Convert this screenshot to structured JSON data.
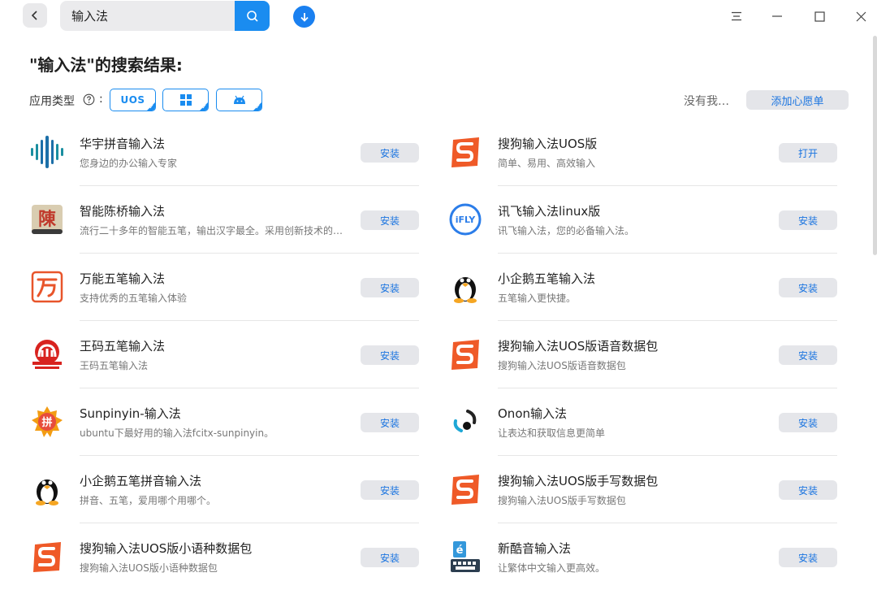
{
  "search": {
    "value": "输入法"
  },
  "results_title": "\"输入法\"的搜索结果:",
  "filter": {
    "label": "应用类型",
    "colon": ":",
    "uos_chip": "UOS",
    "no_find": "没有我…",
    "wish_button": "添加心愿单"
  },
  "colors": {
    "accent": "#1a8cf0",
    "button_bg": "#e5e6ea",
    "button_text": "#1a74e0"
  },
  "apps": [
    {
      "name": "华宇拼音输入法",
      "desc": "您身边的办公输入专家",
      "button": "安装",
      "icon": "huayu-pinyin-icon"
    },
    {
      "name": "搜狗输入法UOS版",
      "desc": "简单、易用、高效输入",
      "button": "打开",
      "icon": "sogou-icon"
    },
    {
      "name": "智能陈桥输入法",
      "desc": "流行二十多年的智能五笔，输出汉字最全。采用创新技术的…",
      "button": "安装",
      "icon": "chenqiao-icon"
    },
    {
      "name": "讯飞输入法linux版",
      "desc": "讯飞输入法，您的必备输入法。",
      "button": "安装",
      "icon": "ifly-icon"
    },
    {
      "name": "万能五笔输入法",
      "desc": "支持优秀的五笔输入体验",
      "button": "安装",
      "icon": "wanneng-wubi-icon"
    },
    {
      "name": "小企鹅五笔输入法",
      "desc": "五笔输入更快捷。",
      "button": "安装",
      "icon": "penguin-icon"
    },
    {
      "name": "王码五笔输入法",
      "desc": "王码五笔输入法",
      "button": "安装",
      "icon": "wangma-icon"
    },
    {
      "name": "搜狗输入法UOS版语音数据包",
      "desc": "搜狗输入法UOS版语音数据包",
      "button": "安装",
      "icon": "sogou-icon"
    },
    {
      "name": "Sunpinyin-输入法",
      "desc": "ubuntu下最好用的输入法fcitx-sunpinyin。",
      "button": "安装",
      "icon": "sunpinyin-icon"
    },
    {
      "name": "Onon输入法",
      "desc": "让表达和获取信息更简单",
      "button": "安装",
      "icon": "onon-icon"
    },
    {
      "name": "小企鹅五笔拼音输入法",
      "desc": "拼音、五笔，爱用哪个用哪个。",
      "button": "安装",
      "icon": "penguin-icon"
    },
    {
      "name": "搜狗输入法UOS版手写数据包",
      "desc": "搜狗输入法UOS版手写数据包",
      "button": "安装",
      "icon": "sogou-icon"
    },
    {
      "name": "搜狗输入法UOS版小语种数据包",
      "desc": "搜狗输入法UOS版小语种数据包",
      "button": "安装",
      "icon": "sogou-icon"
    },
    {
      "name": "新酷音输入法",
      "desc": "让繁体中文输入更高效。",
      "button": "安装",
      "icon": "chewing-icon"
    }
  ]
}
